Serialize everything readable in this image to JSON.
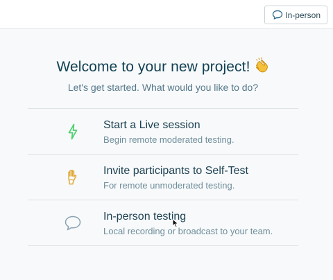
{
  "topbar": {
    "mode_label": "In-person"
  },
  "welcome": {
    "title": "Welcome to your new project!",
    "subtitle": "Let's get started. What would you like to do?"
  },
  "options": [
    {
      "icon": "lightning-icon",
      "title": "Start a Live session",
      "description": "Begin remote moderated testing.",
      "color": "#4ccf6e"
    },
    {
      "icon": "raised-hand-icon",
      "title": "Invite participants to Self-Test",
      "description": "For remote unmoderated testing.",
      "color": "#e0a733"
    },
    {
      "icon": "speech-bubble-icon",
      "title": "In-person testing",
      "description": "Local recording or broadcast to your team.",
      "color": "#8aa3b0"
    }
  ],
  "colors": {
    "heading": "#103f52",
    "subtitle": "#56788a",
    "background": "#f7f9fa"
  }
}
